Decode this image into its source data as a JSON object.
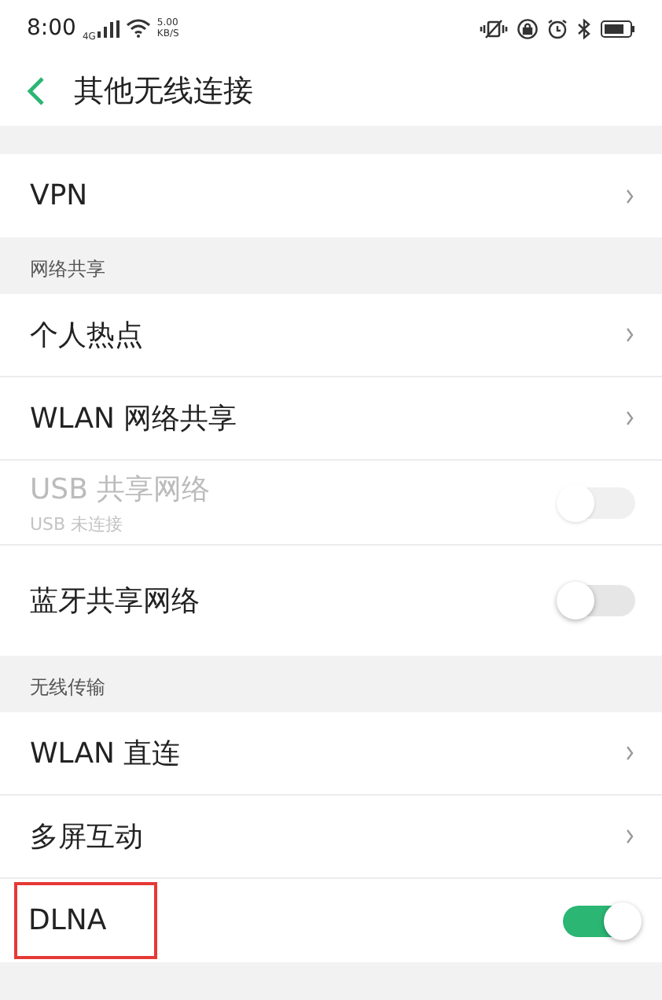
{
  "status_bar": {
    "time": "8:00",
    "network": "4G",
    "speed_value": "5.00",
    "speed_unit": "KB/S"
  },
  "header": {
    "title": "其他无线连接"
  },
  "sections": [
    {
      "items": [
        {
          "kind": "link",
          "label": "VPN",
          "disabled": false,
          "highlighted": false
        }
      ]
    },
    {
      "title": "网络共享",
      "items": [
        {
          "kind": "link",
          "label": "个人热点",
          "disabled": false,
          "highlighted": false
        },
        {
          "kind": "link",
          "label": "WLAN 网络共享",
          "disabled": false,
          "highlighted": false
        },
        {
          "kind": "switch",
          "label": "USB 共享网络",
          "subtitle": "USB 未连接",
          "disabled": true,
          "on": false,
          "highlighted": false
        },
        {
          "kind": "switch",
          "label": "蓝牙共享网络",
          "disabled": false,
          "on": false,
          "highlighted": false
        }
      ]
    },
    {
      "title": "无线传输",
      "items": [
        {
          "kind": "link",
          "label": "WLAN 直连",
          "disabled": false,
          "highlighted": false
        },
        {
          "kind": "link",
          "label": "多屏互动",
          "disabled": false,
          "highlighted": false
        },
        {
          "kind": "switch",
          "label": "DLNA",
          "disabled": false,
          "on": true,
          "highlighted": true
        }
      ]
    }
  ]
}
